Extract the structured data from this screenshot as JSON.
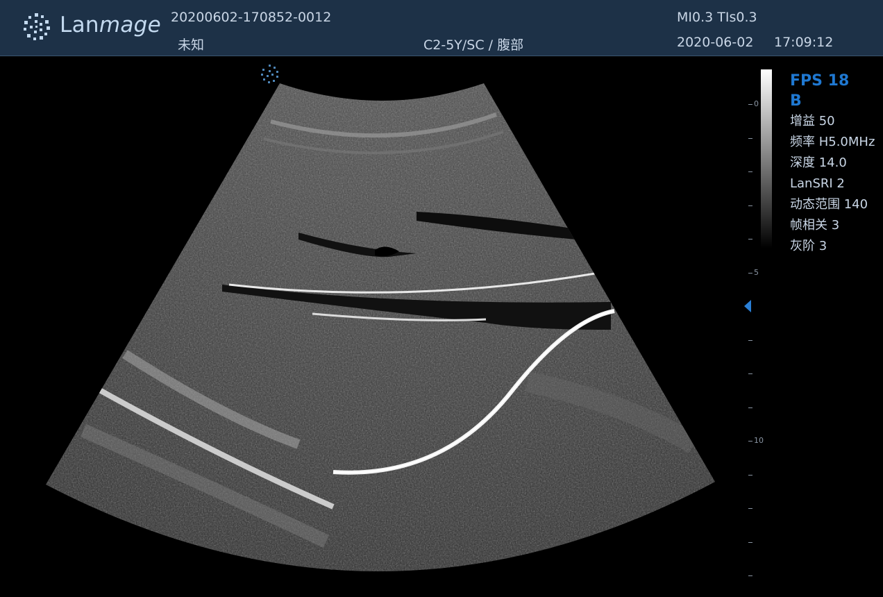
{
  "header": {
    "brand_prefix": "Lan",
    "brand_suffix": "mage",
    "patient_id": "20200602-170852-0012",
    "patient_name": "未知",
    "probe_preset": "C2-5Y/SC / 腹部",
    "mi_tis": "MI0.3 TIs0.3",
    "date": "2020-06-02",
    "time": "17:09:12"
  },
  "depth_scale": {
    "labels": [
      "0",
      "5",
      "10"
    ]
  },
  "params": {
    "fps": "FPS 18",
    "mode": "B",
    "items": [
      "增益 50",
      "频率 H5.0MHz",
      "深度 14.0",
      "LanSRI 2",
      "动态范围 140",
      "帧相关 3",
      "灰阶 3"
    ]
  },
  "colors": {
    "header_bg": "#1d3147",
    "accent": "#1f78d1",
    "text": "#c9d6e6"
  }
}
